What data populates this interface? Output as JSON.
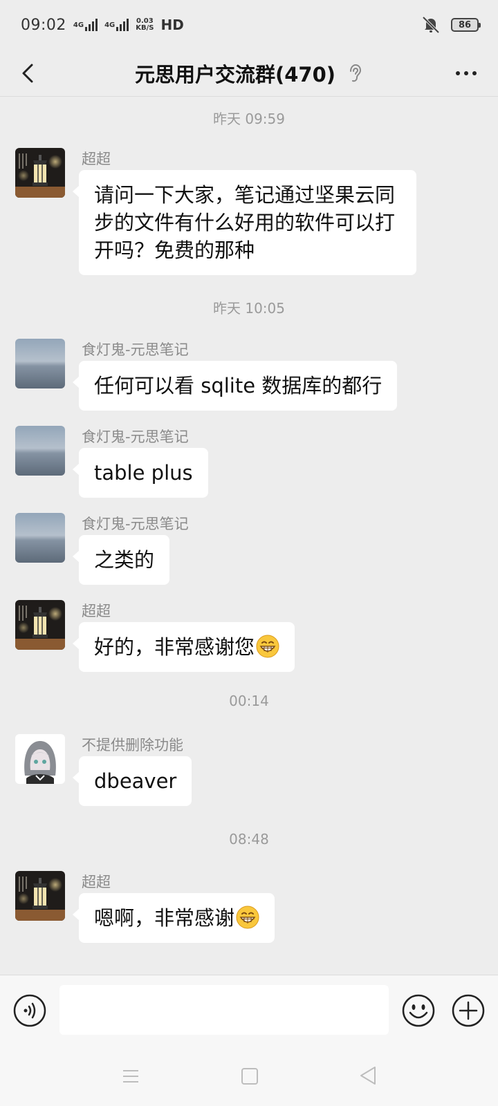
{
  "status_bar": {
    "time": "09:02",
    "signal_1_label": "4G",
    "signal_2_label": "4G",
    "net_speed_value": "0.03",
    "net_speed_unit": "KB/S",
    "hd_label": "HD",
    "battery_level": "86",
    "icons": [
      "signal-icon",
      "bell-muted-icon",
      "battery-icon"
    ]
  },
  "header": {
    "title": "元思用户交流群(470)",
    "icons": [
      "back-arrow-icon",
      "ear-icon",
      "more-dots-icon"
    ]
  },
  "chat": {
    "timestamps": [
      "昨天 09:59",
      "昨天 10:05",
      "00:14",
      "08:48"
    ],
    "messages": [
      {
        "sender": "超超",
        "text": "请问一下大家，笔记通过坚果云同步的文件有什么好用的软件可以打开吗？免费的那种",
        "avatar": "lantern-avatar"
      },
      {
        "sender": "食灯鬼-元思笔记",
        "text": "任何可以看 sqlite 数据库的都行",
        "avatar": "sea-avatar"
      },
      {
        "sender": "食灯鬼-元思笔记",
        "text": "table plus",
        "avatar": "sea-avatar"
      },
      {
        "sender": "食灯鬼-元思笔记",
        "text": "之类的",
        "avatar": "sea-avatar"
      },
      {
        "sender": "超超",
        "text": "好的，非常感谢您",
        "emoji": "grin-emoji",
        "avatar": "lantern-avatar"
      },
      {
        "sender": "不提供删除功能",
        "text": "dbeaver",
        "avatar": "anime-avatar"
      },
      {
        "sender": "超超",
        "text": "嗯啊，非常感谢",
        "emoji": "grin-emoji",
        "avatar": "lantern-avatar"
      }
    ]
  },
  "input_bar": {
    "value": "",
    "placeholder": "",
    "icons": [
      "voice-icon",
      "emoji-icon",
      "plus-icon"
    ]
  },
  "nav_bar": {
    "icons": [
      "menu-icon",
      "home-square-icon",
      "back-triangle-icon"
    ]
  },
  "colors": {
    "background": "#ededed",
    "bubble": "#ffffff",
    "secondary_text": "#8a8a8a",
    "primary_text": "#111111"
  }
}
